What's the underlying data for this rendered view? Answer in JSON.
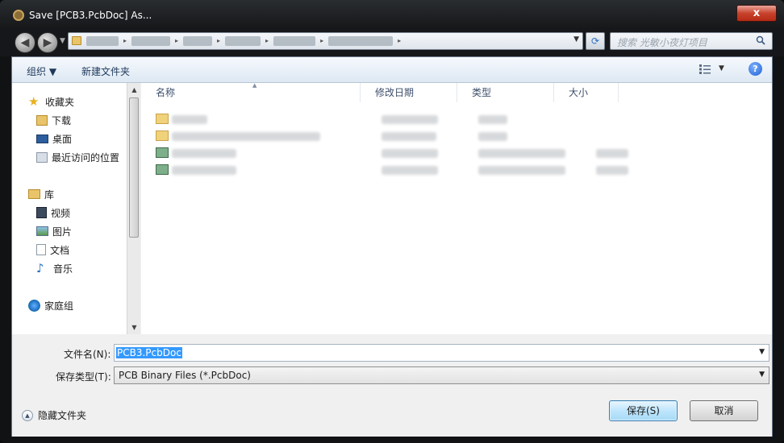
{
  "window": {
    "title": "Save [PCB3.PcbDoc] As...",
    "close_label": "x"
  },
  "nav": {
    "back_label": "◀",
    "forward_label": "▶",
    "search_placeholder": "搜索 光敏小夜灯项目"
  },
  "toolbar": {
    "organize_label": "组织 ▼",
    "new_folder_label": "新建文件夹",
    "help_label": "?"
  },
  "sidebar": {
    "favorites": {
      "label": "收藏夹"
    },
    "favorites_items": [
      {
        "label": "下载"
      },
      {
        "label": "桌面"
      },
      {
        "label": "最近访问的位置"
      }
    ],
    "libraries": {
      "label": "库"
    },
    "library_items": [
      {
        "label": "视频"
      },
      {
        "label": "图片"
      },
      {
        "label": "文档"
      },
      {
        "label": "音乐"
      }
    ],
    "homegroup": {
      "label": "家庭组"
    }
  },
  "columns": [
    {
      "label": "名称"
    },
    {
      "label": "修改日期"
    },
    {
      "label": "类型"
    },
    {
      "label": "大小"
    }
  ],
  "form": {
    "filename_label": "文件名(N):",
    "filename_value": "PCB3.PcbDoc",
    "filetype_label": "保存类型(T):",
    "filetype_value": "PCB Binary Files (*.PcbDoc)",
    "hide_folders_label": "隐藏文件夹",
    "save_label": "保存(S)",
    "cancel_label": "取消"
  },
  "colors": {
    "accent": "#3399ff",
    "title_bg": "#15171a",
    "close": "#c8422c"
  }
}
